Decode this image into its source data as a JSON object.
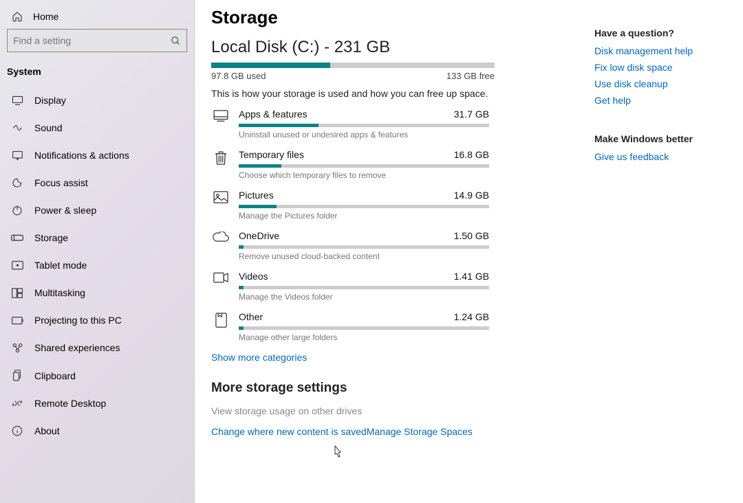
{
  "sidebar": {
    "home": "Home",
    "search_placeholder": "Find a setting",
    "section": "System",
    "items": [
      {
        "label": "Display"
      },
      {
        "label": "Sound"
      },
      {
        "label": "Notifications & actions"
      },
      {
        "label": "Focus assist"
      },
      {
        "label": "Power & sleep"
      },
      {
        "label": "Storage"
      },
      {
        "label": "Tablet mode"
      },
      {
        "label": "Multitasking"
      },
      {
        "label": "Projecting to this PC"
      },
      {
        "label": "Shared experiences"
      },
      {
        "label": "Clipboard"
      },
      {
        "label": "Remote Desktop"
      },
      {
        "label": "About"
      }
    ]
  },
  "page": {
    "title": "Storage",
    "disk_title": "Local Disk (C:) - 231 GB",
    "disk_used_pct": 42,
    "disk_used_label": "97.8 GB used",
    "disk_free_label": "133 GB free",
    "body": "This is how your storage is used and how you can free up space."
  },
  "categories": [
    {
      "label": "Apps & features",
      "size": "31.7 GB",
      "desc": "Uninstall unused or undesired apps & features",
      "pct": 32
    },
    {
      "label": "Temporary files",
      "size": "16.8 GB",
      "desc": "Choose which temporary files to remove",
      "pct": 17
    },
    {
      "label": "Pictures",
      "size": "14.9 GB",
      "desc": "Manage the Pictures folder",
      "pct": 15
    },
    {
      "label": "OneDrive",
      "size": "1.50 GB",
      "desc": "Remove unused cloud-backed content",
      "pct": 2
    },
    {
      "label": "Videos",
      "size": "1.41 GB",
      "desc": "Manage the Videos folder",
      "pct": 2
    },
    {
      "label": "Other",
      "size": "1.24 GB",
      "desc": "Manage other large folders",
      "pct": 2
    }
  ],
  "show_more": "Show more categories",
  "more_section": {
    "title": "More storage settings",
    "items": [
      {
        "label": "View storage usage on other drives",
        "active": false
      },
      {
        "label": "Change where new content is saved",
        "active": true
      },
      {
        "label": "Manage Storage Spaces",
        "active": true
      }
    ]
  },
  "right": {
    "q_head": "Have a question?",
    "q_links": [
      "Disk management help",
      "Fix low disk space",
      "Use disk cleanup",
      "Get help"
    ],
    "fb_head": "Make Windows better",
    "fb_link": "Give us feedback"
  }
}
